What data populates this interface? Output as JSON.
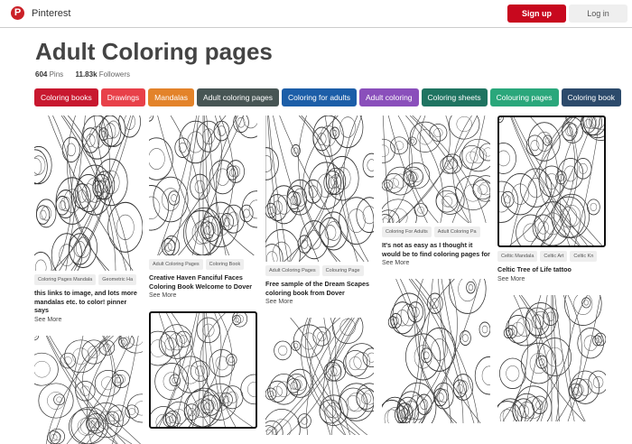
{
  "header": {
    "brand": "Pinterest",
    "signup": "Sign up",
    "login": "Log in"
  },
  "board": {
    "title": "Adult Coloring pages",
    "pins": "604",
    "pins_label": "Pins",
    "followers": "11.83k",
    "followers_label": "Followers"
  },
  "tags": [
    {
      "label": "Coloring books",
      "color": "#c8182f"
    },
    {
      "label": "Drawings",
      "color": "#e84049"
    },
    {
      "label": "Mandalas",
      "color": "#e3832a"
    },
    {
      "label": "Adult coloring pages",
      "color": "#475554"
    },
    {
      "label": "Coloring for adults",
      "color": "#1c5ea8"
    },
    {
      "label": "Adult coloring",
      "color": "#8a4fbb"
    },
    {
      "label": "Coloring sheets",
      "color": "#1f7461"
    },
    {
      "label": "Colouring pages",
      "color": "#2aa77b"
    },
    {
      "label": "Coloring book",
      "color": "#2c4a6b"
    }
  ],
  "pins": [
    {
      "tags": [
        "Coloring Pages Mandala",
        "Geometric Ha"
      ],
      "desc": "this links to image, and lots more mandalas etc. to color! pinner says",
      "more": "See More"
    },
    {
      "tags": [
        "Adult Coloring Pages",
        "Coloring Book"
      ],
      "desc": "Creative Haven Fanciful Faces Coloring Book Welcome to Dover",
      "more": "See More"
    },
    {
      "tags": [
        "Adult Coloring Pages",
        "Colouring Page"
      ],
      "desc": "Free sample of the Dream Scapes coloring book from Dover",
      "more": "See More"
    },
    {
      "tags": [
        "Coloring For Adults",
        "Adult Coloring Pa"
      ],
      "desc": "It's not as easy as I thought it would be to find coloring pages for",
      "more": "See More"
    },
    {
      "tags": [
        "Celtic Mandala",
        "Celtic Art",
        "Celtic Kn"
      ],
      "desc": "Celtic Tree of Life tattoo",
      "more": "See More"
    }
  ]
}
